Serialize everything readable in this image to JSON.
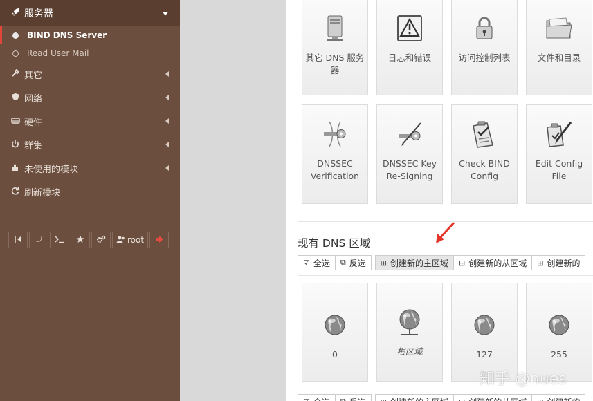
{
  "sidebar": {
    "header": {
      "label": "服务器",
      "icon": "rocket-icon"
    },
    "modules": [
      {
        "label": "BIND DNS Server",
        "active": true
      },
      {
        "label": "Read User Mail",
        "active": false
      }
    ],
    "items": [
      {
        "label": "其它",
        "icon": "wrench-icon"
      },
      {
        "label": "网络",
        "icon": "shield-icon"
      },
      {
        "label": "硬件",
        "icon": "hdd-icon"
      },
      {
        "label": "群集",
        "icon": "power-icon"
      },
      {
        "label": "未使用的模块",
        "icon": "puzzle-icon"
      },
      {
        "label": "刷新模块",
        "icon": "refresh-icon"
      }
    ],
    "toolbar": {
      "user": "root"
    }
  },
  "tiles_row1": [
    {
      "label": "其它 DNS 服务器",
      "icon": "server-icon"
    },
    {
      "label": "日志和错误",
      "icon": "warning-icon"
    },
    {
      "label": "访问控制列表",
      "icon": "lock-icon"
    },
    {
      "label": "文件和目录",
      "icon": "folder-icon"
    }
  ],
  "tiles_row2": [
    {
      "label": "DNSSEC Verification",
      "icon": "key-icon"
    },
    {
      "label": "DNSSEC Key Re-Signing",
      "icon": "key-resign-icon"
    },
    {
      "label": "Check BIND Config",
      "icon": "checklist-icon"
    },
    {
      "label": "Edit Config File",
      "icon": "edit-file-icon"
    }
  ],
  "zones_section": {
    "title": "现有 DNS 区域",
    "buttons": {
      "select_all": "全选",
      "invert": "反选",
      "create_master": "创建新的主区域",
      "create_slave": "创建新的从区域",
      "create_more": "创建新的"
    },
    "zones": [
      {
        "label": "0",
        "italic": false
      },
      {
        "label": "根区域",
        "italic": true
      },
      {
        "label": "127",
        "italic": false
      },
      {
        "label": "255",
        "italic": false
      }
    ]
  },
  "watermark": "知乎 @nues",
  "colors": {
    "sidebar": "#6b4e3d",
    "active_marker": "#e2463b",
    "arrow": "#e3342a"
  }
}
